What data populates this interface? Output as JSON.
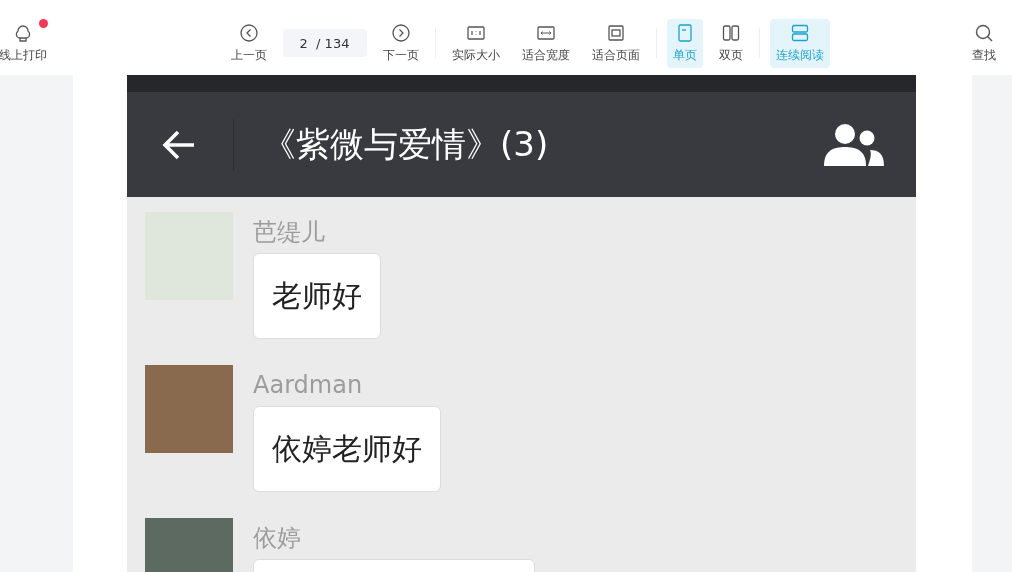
{
  "toolbar": {
    "print": {
      "label": "线上打印",
      "badge": true
    },
    "items": [
      {
        "kind": "button",
        "label": "上一页"
      },
      {
        "kind": "page",
        "current": "2",
        "total": "/ 134"
      },
      {
        "kind": "button",
        "label": "下一页"
      },
      {
        "kind": "separator"
      },
      {
        "kind": "button",
        "label": "实际大小"
      },
      {
        "kind": "button",
        "label": "适合宽度"
      },
      {
        "kind": "button",
        "label": "适合页面"
      },
      {
        "kind": "separator"
      },
      {
        "kind": "toggle",
        "label": "单页",
        "selected": true
      },
      {
        "kind": "toggle",
        "label": "双页",
        "selected": false
      },
      {
        "kind": "separator"
      },
      {
        "kind": "toggle",
        "label": "连续阅读",
        "selected": true
      }
    ],
    "search": {
      "label": "查找"
    }
  },
  "chat": {
    "title": "《紫微与爱情》(3)",
    "messages": [
      {
        "name": "芭缇儿",
        "text": "老师好"
      },
      {
        "name": "Aardman",
        "text": "依婷老师好"
      },
      {
        "name": "依婷"
      }
    ]
  }
}
